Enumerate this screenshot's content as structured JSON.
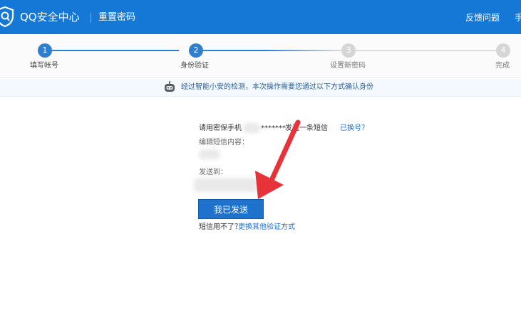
{
  "header": {
    "brand": "QQ安全中心",
    "subtitle": "重置密码",
    "feedback": "反馈问题",
    "more": "手"
  },
  "steps": [
    {
      "num": "1",
      "label": "填写帐号",
      "state": "done"
    },
    {
      "num": "2",
      "label": "身份验证",
      "state": "active"
    },
    {
      "num": "3",
      "label": "设置新密码",
      "state": "todo"
    },
    {
      "num": "4",
      "label": "完成",
      "state": "todo"
    }
  ],
  "notice": {
    "text": "经过智能小安的检测，本次操作需要您通过以下方式确认身份"
  },
  "sms": {
    "line1_prefix": "请用密保手机",
    "line1_masked": "*******",
    "line1_suffix": "发送一条短信",
    "changed_link": "已换号？",
    "content_label": "编辑短信内容：",
    "send_to_label": "发送到：",
    "send_button": "我已发送",
    "alt_text": "短信用不了？",
    "alt_link": "更换其他验证方式"
  },
  "colors": {
    "header_bg": "#1678d6",
    "step_active": "#2f7fd0",
    "step_inactive": "#d6d6d6",
    "button": "#1f72cc",
    "arrow": "#e8323a"
  }
}
